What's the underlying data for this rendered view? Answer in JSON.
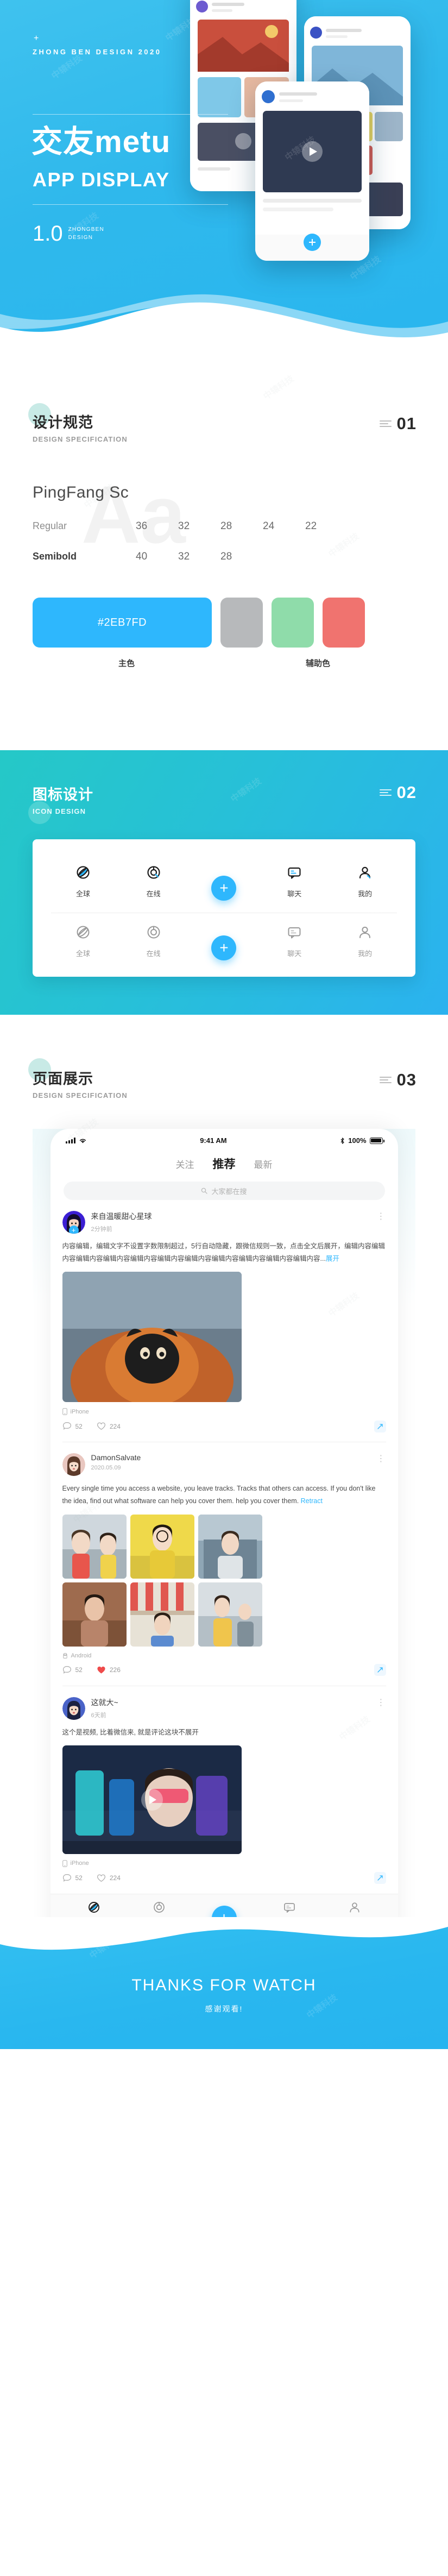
{
  "hero": {
    "plus": "+",
    "brand": "ZHONG BEN DESIGN 2020",
    "title": "交友metu",
    "subtitle": "APP DISPLAY",
    "version": "1.0",
    "version_caption_line1": "ZHONGBEN",
    "version_caption_line2": "DESIGN"
  },
  "spec": {
    "cn_title": "设计规范",
    "en_title": "DESIGN SPECIFICATION",
    "number": "01",
    "watermark": "Aa",
    "font_family": "PingFang  Sc",
    "rows": [
      {
        "weight": "Regular",
        "sizes": [
          "36",
          "32",
          "28",
          "24",
          "22"
        ]
      },
      {
        "weight": "Semibold",
        "sizes": [
          "40",
          "32",
          "28"
        ]
      }
    ],
    "main_color_hex": "#2EB7FD",
    "main_color_label": "主色",
    "aux_color_label": "辅助色",
    "aux_colors": [
      "#B7B9BB",
      "#8FDCAA",
      "#F0736F"
    ]
  },
  "icons": {
    "cn_title": "图标设计",
    "en_title": "ICON DESIGN",
    "number": "02",
    "row_labels": [
      "全球",
      "在线",
      "",
      "聊天",
      "我的"
    ],
    "fab_symbol": "+"
  },
  "display": {
    "cn_title": "页面展示",
    "en_title": "DESIGN SPECIFICATION",
    "number": "03"
  },
  "phone": {
    "status": {
      "time": "9:41 AM",
      "battery": "100%"
    },
    "tabs": [
      {
        "label": "关注",
        "active": false
      },
      {
        "label": "推荐",
        "active": true
      },
      {
        "label": "最新",
        "active": false
      }
    ],
    "search_placeholder": "大家都在搜",
    "posts": [
      {
        "author": "来自温暖甜心星球",
        "time": "2分钟前",
        "text": "内容编辑，编辑文字不设置字数限制超过，5行自动隐藏，跟微信规则一致，点击全文后展开，编辑内容编辑内容编辑内容编辑内容编辑内容编辑内容编辑内容编辑内容编辑内容编辑内容编辑内容...",
        "more_label": "展开",
        "device": "iPhone",
        "comments": "52",
        "likes": "224",
        "liked": false,
        "media_type": "single"
      },
      {
        "author": "DamonSalvate",
        "time": "2020.05.09",
        "text": "Every single time you access a website, you leave tracks. Tracks that others can access. If you don't like the idea, find out what software can help you cover them. help you cover them.",
        "more_label": "Retract",
        "device": "Android",
        "comments": "52",
        "likes": "226",
        "liked": true,
        "media_type": "grid"
      },
      {
        "author": "这就大~",
        "time": "6天前",
        "text": "这个是视频, 比着微信来, 就是评论这块不展开",
        "more_label": "",
        "device": "iPhone",
        "comments": "52",
        "likes": "224",
        "liked": false,
        "media_type": "video"
      }
    ],
    "bottom_nav": [
      {
        "label": "全球",
        "active": true
      },
      {
        "label": "在线",
        "active": false
      },
      {
        "label": "",
        "active": false
      },
      {
        "label": "聊天",
        "active": false
      },
      {
        "label": "我的",
        "active": false
      }
    ]
  },
  "footer": {
    "title": "THANKS FOR WATCH",
    "subtitle": "感谢观看!"
  },
  "watermark_text": "中辕科技"
}
